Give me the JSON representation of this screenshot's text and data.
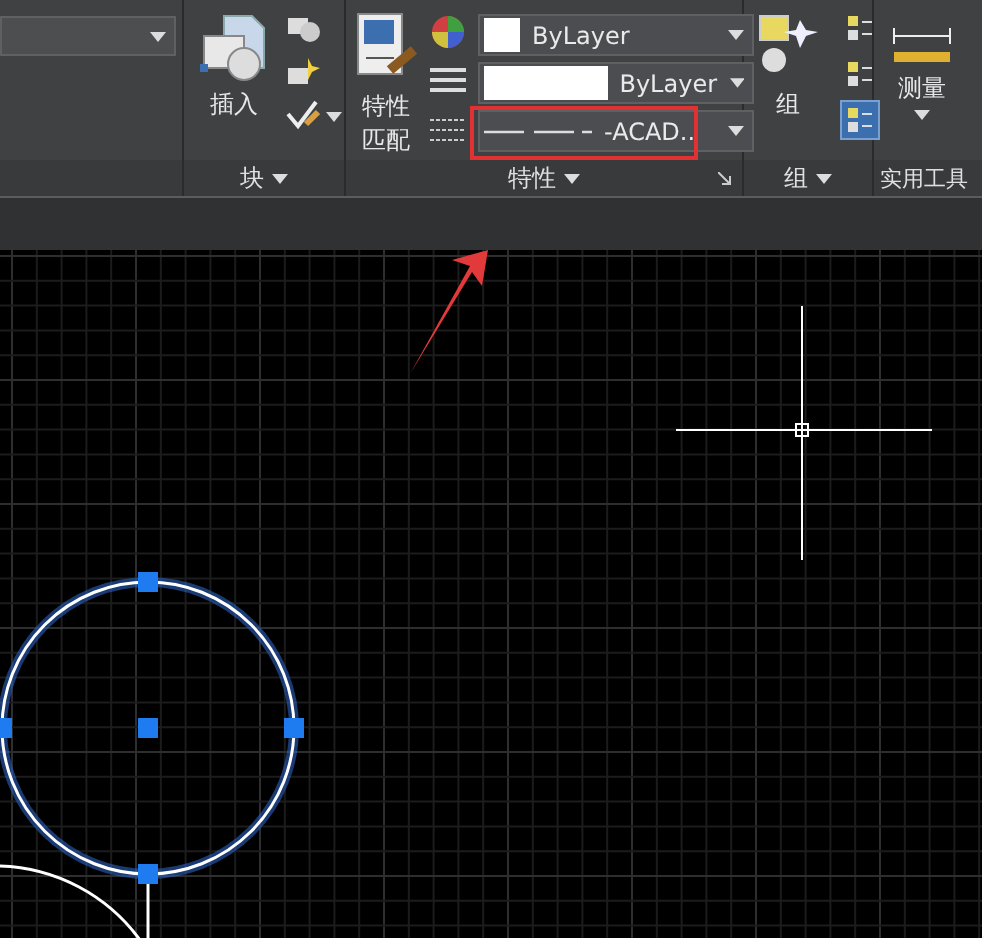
{
  "ribbon": {
    "block_panel": {
      "title": "块",
      "insert_button": "插入"
    },
    "properties_panel": {
      "title": "特性",
      "match_button": [
        "特性",
        "匹配"
      ],
      "dropdowns": [
        {
          "kind": "color",
          "value": "ByLayer"
        },
        {
          "kind": "lineweight",
          "value": "ByLayer"
        },
        {
          "kind": "linetype",
          "value": "-ACAD.."
        }
      ]
    },
    "group_panel": {
      "title": "组",
      "group_button": "组",
      "tools": [
        {
          "selected": false
        },
        {
          "selected": false
        },
        {
          "selected": true
        }
      ]
    },
    "utilities_panel": {
      "title": "实用工具",
      "measure_button": "测量"
    }
  }
}
